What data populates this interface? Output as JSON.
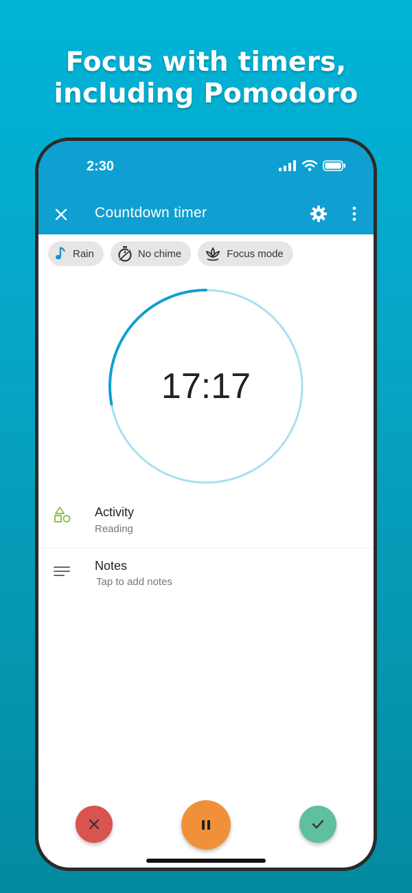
{
  "headline": {
    "line1": "Focus with timers,",
    "line2": "including Pomodoro"
  },
  "status_bar": {
    "time": "2:30",
    "icons": [
      "signal-icon",
      "wifi-icon",
      "battery-icon"
    ]
  },
  "app_bar": {
    "title": "Countdown timer",
    "icons": [
      "close-icon",
      "gear-icon",
      "more-vert-icon"
    ],
    "color": "#0f9fd1"
  },
  "chips": [
    {
      "label": "Rain",
      "icon": "music-note-icon"
    },
    {
      "label": "No chime",
      "icon": "timer-icon"
    },
    {
      "label": "Focus mode",
      "icon": "lotus-icon"
    }
  ],
  "timer": {
    "display": "17:17",
    "elapsed_fraction": 0.28,
    "progress_color": "#0f9fd1",
    "track_color": "#a9dff0"
  },
  "details": {
    "activity": {
      "label": "Activity",
      "value": "Reading",
      "icon": "shapes-icon",
      "icon_color": "#8bc34a"
    },
    "notes": {
      "label": "Notes",
      "placeholder": "Tap to add notes",
      "icon": "notes-icon"
    }
  },
  "actions": {
    "cancel": {
      "icon": "close-icon",
      "color": "#d9534f"
    },
    "pause": {
      "icon": "pause-icon",
      "color": "#f0913a"
    },
    "complete": {
      "icon": "check-icon",
      "color": "#5fbf9f"
    }
  }
}
